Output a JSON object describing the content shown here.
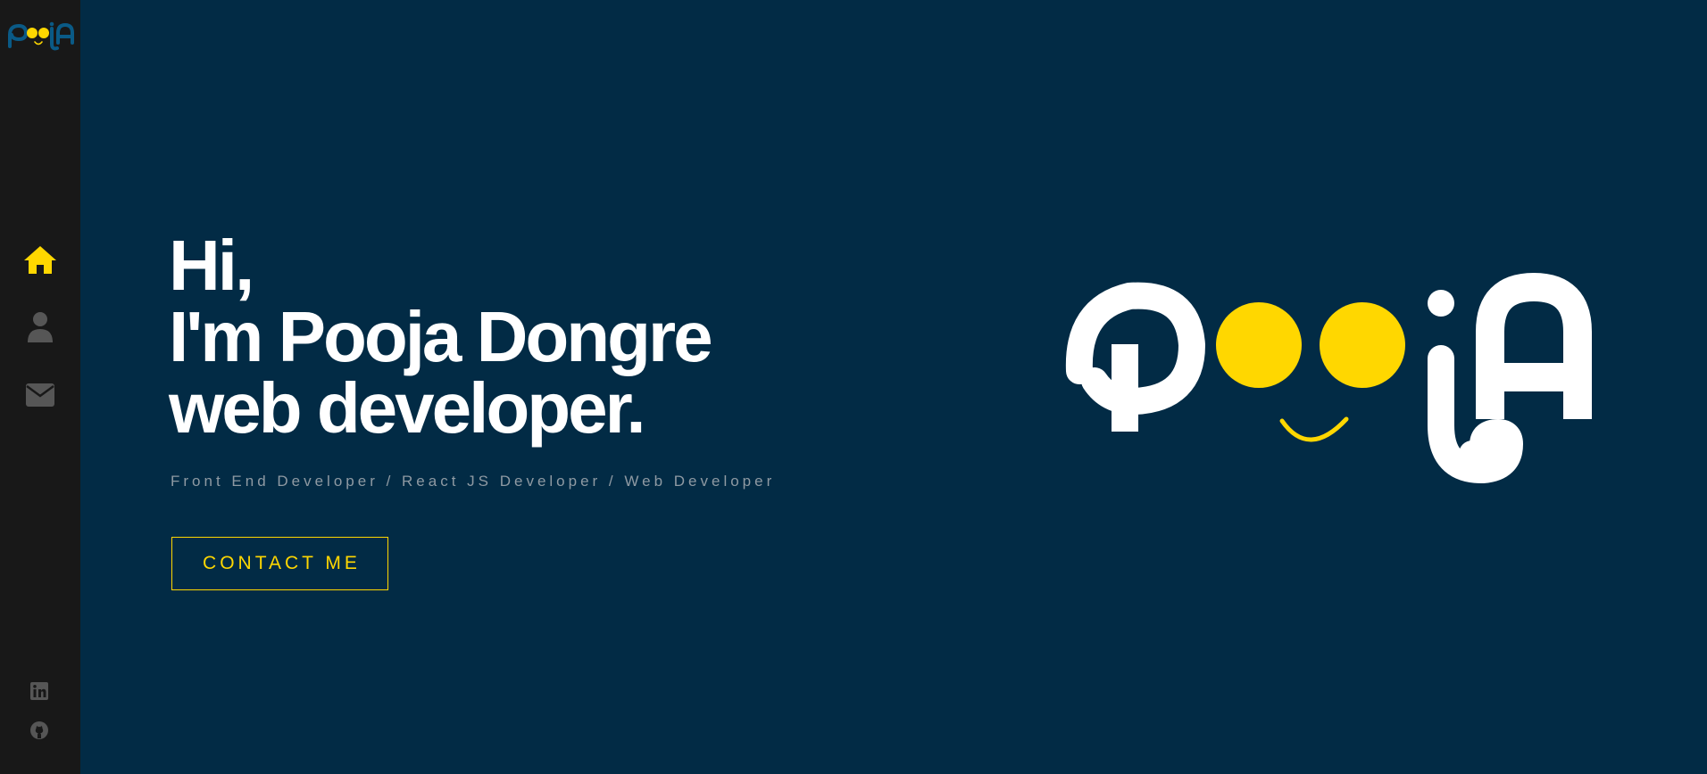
{
  "sidebar": {
    "logo_name": "pooja-logo",
    "nav": [
      {
        "name": "home",
        "icon": "home-icon",
        "active": true
      },
      {
        "name": "about",
        "icon": "user-icon",
        "active": false
      },
      {
        "name": "contact",
        "icon": "envelope-icon",
        "active": false
      }
    ],
    "social": [
      {
        "name": "linkedin",
        "icon": "linkedin-icon"
      },
      {
        "name": "github",
        "icon": "github-icon"
      }
    ]
  },
  "hero": {
    "line1": "Hi,",
    "line2": "I'm Pooja Dongre",
    "line3": "web developer.",
    "subtitle": "Front End Developer / React JS Developer / Web Developer",
    "button_label": "CONTACT ME"
  },
  "colors": {
    "background": "#022b45",
    "sidebar": "#181818",
    "accent": "#ffd700",
    "text": "#ffffff",
    "muted": "#8f9aa3",
    "icon_inactive": "#565656"
  }
}
